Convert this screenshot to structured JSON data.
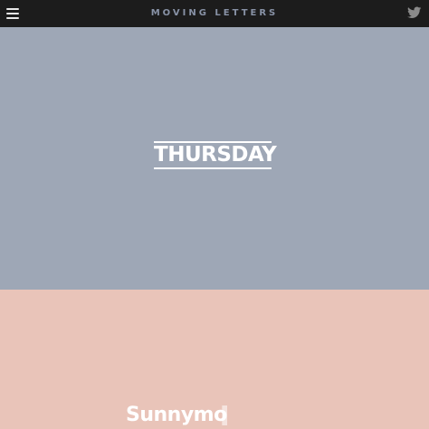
{
  "header": {
    "brand": "MOVING LETTERS",
    "menu_icon": "hamburger-menu-icon",
    "social_icon": "twitter-icon"
  },
  "panels": {
    "top": {
      "text": "THURSDAY",
      "bg": "#9ea7b6"
    },
    "bottom": {
      "text": "Sunnymo",
      "letter_o": "r",
      "letter_n": "n",
      "bg": "#e9c4b9"
    }
  },
  "colors": {
    "topbar": "#1c1c1c",
    "brand": "#8892a6",
    "text": "#ffffff"
  }
}
